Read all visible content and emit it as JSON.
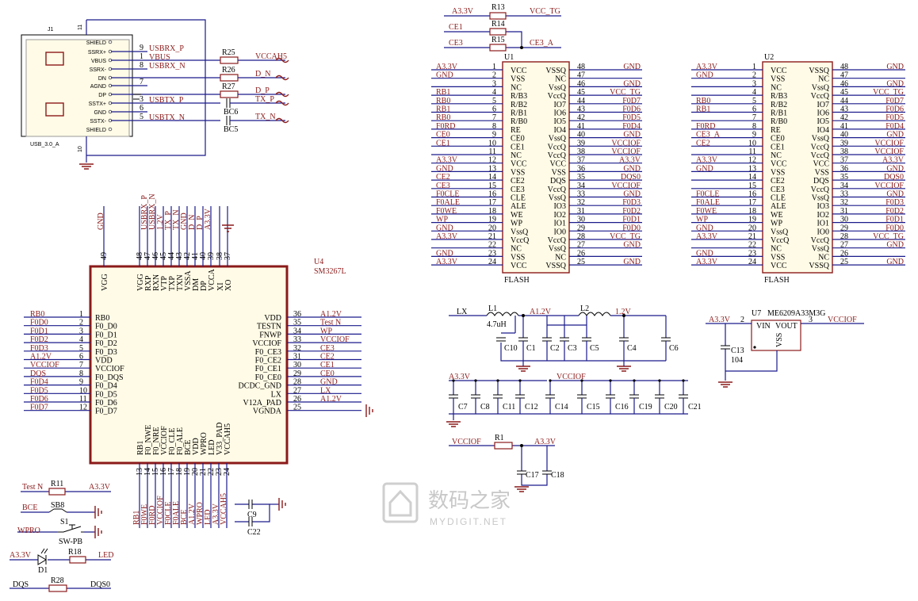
{
  "watermark": {
    "text_cn": "数码之家",
    "text_en": "MYDIGIT.NET"
  },
  "usb": {
    "ref": "J1",
    "part": "USB_3.0_A",
    "pins_inner": [
      "SHIELD",
      "SSRX+",
      "VBUS",
      "SSRX-",
      "DN",
      "AGND",
      "DP",
      "SSTX+",
      "GND",
      "SSTX-",
      "SHIELD"
    ],
    "pin_nums": [
      "11",
      "9",
      "1",
      "8",
      "",
      "7",
      "",
      "3",
      "6",
      "5",
      "10"
    ],
    "net_labels": [
      "USBRX_P",
      "VBUS",
      "USBRX_N",
      "USBTX_P",
      "USBTX_N"
    ],
    "r25": "R25",
    "r26": "R26",
    "r27": "R27",
    "bc6": "BC6",
    "bc5": "BC5",
    "nets_right": [
      "VCCAH5",
      "D_N",
      "D_P",
      "TX_P",
      "TX_N"
    ]
  },
  "u4": {
    "ref": "U4",
    "part": "SM3267L",
    "top_pins": [
      "49",
      "48",
      "47",
      "46",
      "45",
      "44",
      "43",
      "42",
      "41",
      "40",
      "39",
      "38",
      "37"
    ],
    "top_names": [
      "VGG",
      "VGG",
      "RXP",
      "RXN",
      "VTP",
      "TXP",
      "TXN",
      "VSSA",
      "DM",
      "DP",
      "VCCA",
      "XI",
      "XO"
    ],
    "top_nets": [
      "GND",
      "",
      "USBRX_P",
      "USBRX_N",
      "1.2V",
      "TX_P",
      "TX_N",
      "GND",
      "D_N",
      "D_P",
      "A3.3V",
      "",
      ""
    ],
    "left_pins": [
      "1",
      "2",
      "3",
      "4",
      "5",
      "6",
      "7",
      "8",
      "9",
      "10",
      "11",
      "12"
    ],
    "left_names": [
      "RB0",
      "F0_D0",
      "F0_D1",
      "F0_D2",
      "F0_D3",
      "VDD",
      "VCCIOF",
      "F0_DQS",
      "F0_D4",
      "F0_D5",
      "F0_D6",
      "F0_D7"
    ],
    "left_nets": [
      "RB0",
      "F0D0",
      "F0D1",
      "F0D2",
      "F0D3",
      "A1.2V",
      "VCCIOF",
      "DQS",
      "F0D4",
      "F0D5",
      "F0D6",
      "F0D7"
    ],
    "right_pins": [
      "36",
      "35",
      "34",
      "33",
      "32",
      "31",
      "30",
      "29",
      "28",
      "27",
      "26",
      "25"
    ],
    "right_names": [
      "VDD",
      "TESTN",
      "FNWP",
      "VCCIOF",
      "F0_CE3",
      "F0_CE2",
      "F0_CE1",
      "F0_CE0",
      "DCDC_GND",
      "LX",
      "V12A_PAD",
      "VGNDA"
    ],
    "right_nets": [
      "A1.2V",
      "Test N",
      "WP",
      "VCCIOF",
      "CE3",
      "CE2",
      "CE1",
      "CE0",
      "GND",
      "LX",
      "A1.2V",
      ""
    ],
    "bottom_pins": [
      "13",
      "14",
      "15",
      "16",
      "17",
      "18",
      "19",
      "20",
      "21",
      "22",
      "23",
      "24"
    ],
    "bottom_names": [
      "RB1",
      "F0_NWE",
      "F0_NRE",
      "VCCIOF",
      "F0_CLE",
      "F0_ALE",
      "BCE",
      "VDD",
      "WPRO",
      "LED",
      "V33_PAD",
      "VCCAH5"
    ],
    "bottom_nets": [
      "RB1",
      "F0WE",
      "F0RD",
      "VCCIOF",
      "F0CLE",
      "F0ALE",
      "BCE",
      "A1.2V",
      "WPRO",
      "LED",
      "A3.3V",
      "VCCAH5"
    ],
    "c9": "C9",
    "c22": "C22"
  },
  "top_res": {
    "r13": "R13",
    "r14": "R14",
    "r15": "R15",
    "nets": [
      "A3.3V",
      "VCC_TG",
      "CE1",
      "CE3",
      "CE3_A"
    ]
  },
  "flash1": {
    "ref": "U1",
    "label": "FLASH",
    "left_names": [
      "VCC",
      "VSS",
      "NC",
      "R/B3",
      "R/B2",
      "R/B1",
      "R/B0",
      "RE",
      "CE0",
      "CE1",
      "NC",
      "VCC",
      "VSS",
      "CE2",
      "CE3",
      "CLE",
      "ALE",
      "WE",
      "WP",
      "VssQ",
      "VccQ",
      "NC",
      "VSS",
      "VCC"
    ],
    "left_nets": [
      "A3.3V",
      "GND",
      "",
      "RB1",
      "RB0",
      "RB1",
      "RB0",
      "F0RD",
      "CE0",
      "CE1",
      "",
      "A3.3V",
      "GND",
      "CE2",
      "CE3",
      "F0CLE",
      "F0ALE",
      "F0WE",
      "WP",
      "GND",
      "A3.3V",
      "",
      "GND",
      "A3.3V"
    ],
    "right_names": [
      "VSSQ",
      "NC",
      "VssQ",
      "VccQ",
      "IO7",
      "IO6",
      "IO5",
      "IO4",
      "VssQ",
      "VccQ",
      "VccQ",
      "VCC",
      "VSS",
      "DQS",
      "VccQ",
      "VssQ",
      "IO3",
      "IO2",
      "IO1",
      "IO0",
      "VccQ",
      "VssQ",
      "NC",
      "VSSQ"
    ],
    "right_nets": [
      "GND",
      "",
      "GND",
      "VCC_TG",
      "F0D7",
      "F0D6",
      "F0D5",
      "F0D4",
      "GND",
      "VCCIOF",
      "VCCIOF",
      "A3.3V",
      "GND",
      "DQS0",
      "VCCIOF",
      "GND",
      "F0D3",
      "F0D2",
      "F0D1",
      "F0D0",
      "VCC_TG",
      "GND",
      "",
      "GND"
    ]
  },
  "flash2": {
    "ref": "U2",
    "label": "FLASH",
    "left_nets": [
      "A3.3V",
      "GND",
      "",
      "",
      "RB0",
      "RB1",
      "",
      "F0RD",
      "CE3_A",
      "CE2",
      "",
      "A3.3V",
      "GND",
      "",
      "",
      "F0CLE",
      "F0ALE",
      "F0WE",
      "WP",
      "GND",
      "A3.3V",
      "",
      "GND",
      "A3.3V"
    ],
    "right_nets": [
      "GND",
      "",
      "GND",
      "VCC_TG",
      "F0D7",
      "F0D6",
      "F0D5",
      "F0D4",
      "GND",
      "VCCIOF",
      "VCCIOF",
      "A3.3V",
      "GND",
      "DQS0",
      "VCCIOF",
      "GND",
      "F0D3",
      "F0D2",
      "F0D1",
      "F0D0",
      "VCC_TG",
      "GND",
      "",
      "GND"
    ]
  },
  "power": {
    "l1": "L1",
    "l2": "L2",
    "lx": "LX",
    "val": "4.7uH",
    "a12": "A1.2V",
    "v12": "1.2V",
    "caps1": [
      "C10",
      "C1",
      "C2",
      "C3",
      "C5",
      "C4",
      "C6"
    ],
    "u7": "U7",
    "u7part": "ME6209A33M3G",
    "vin": "VIN",
    "vout": "VOUT",
    "vss": "VSS",
    "c13": "C13",
    "c13val": "104",
    "vcciof": "VCCIOF",
    "a33": "A3.3V",
    "caps2": [
      "C7",
      "C8",
      "C11",
      "C12",
      "C14",
      "C15",
      "C16",
      "C19",
      "C20",
      "C21"
    ],
    "r1": "R1",
    "caps3": [
      "C17",
      "C18"
    ]
  },
  "misc": {
    "testn": "Test N",
    "r11": "R11",
    "a33": "A3.3V",
    "bce": "BCE",
    "sb8": "SB8",
    "wpro": "WPRO",
    "s1": "S1",
    "swpb": "SW-PB",
    "d1": "D1",
    "r18": "R18",
    "led": "LED",
    "dqs": "DQS",
    "r28": "R28",
    "dqs0": "DQS0"
  }
}
